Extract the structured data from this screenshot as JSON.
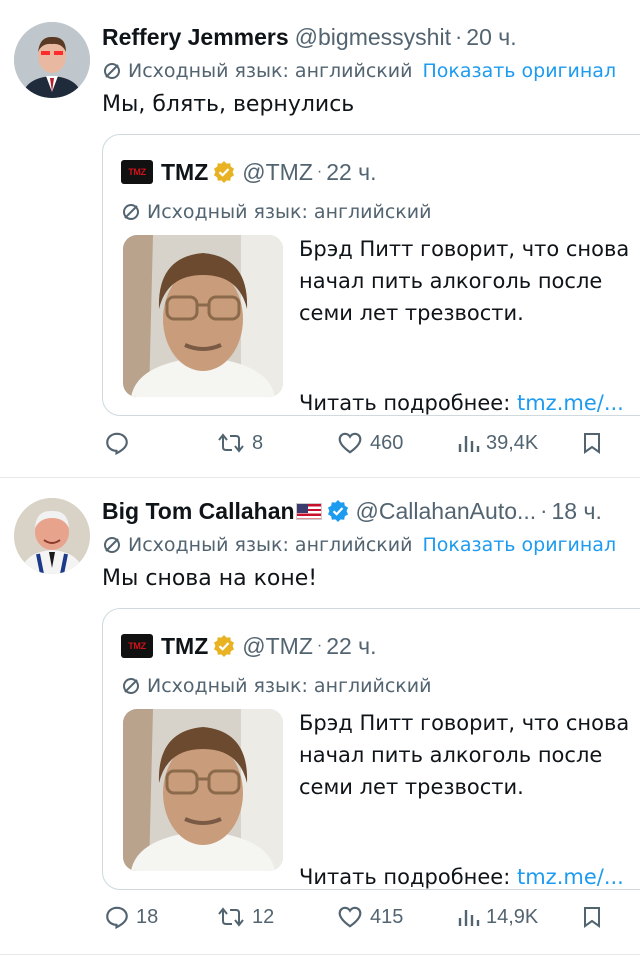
{
  "tweets": [
    {
      "author": {
        "name": "Reffery Jemmers",
        "handle": "@bigmessyshit",
        "time": "20 ч."
      },
      "translated_label": "Исходный язык: английский",
      "show_original": "Показать оригинал",
      "text": "Мы, блять, вернулись",
      "quote": {
        "logo_text": "TMZ",
        "name": "TMZ",
        "handle": "@TMZ",
        "time": "22 ч.",
        "translated_label": "Исходный язык: английский",
        "lines": [
          "Брэд Питт говорит, что снова",
          "начал пить алкоголь после",
          "семи лет трезвости."
        ],
        "read_more": "Читать подробнее: ",
        "link": "tmz.me/..."
      },
      "stats": {
        "replies": "",
        "retweets": "8",
        "likes": "460",
        "views": "39,4K"
      }
    },
    {
      "author": {
        "name": "Big Tom Callahan",
        "handle": "@CallahanAuto...",
        "time": "18 ч."
      },
      "translated_label": "Исходный язык: английский",
      "show_original": "Показать оригинал",
      "text": "Мы снова на коне!",
      "quote": {
        "logo_text": "TMZ",
        "name": "TMZ",
        "handle": "@TMZ",
        "time": "22 ч.",
        "translated_label": "Исходный язык: английский",
        "lines": [
          "Брэд Питт говорит, что снова",
          "начал пить алкоголь после",
          "семи лет трезвости."
        ],
        "read_more": "Читать подробнее: ",
        "link": "tmz.me/..."
      },
      "stats": {
        "replies": "18",
        "retweets": "12",
        "likes": "415",
        "views": "14,9K"
      }
    }
  ],
  "separator": "·",
  "colors": {
    "link": "#1d9bf0",
    "muted": "#536471",
    "verified_blue": "#1d9bf0",
    "verified_gold": "#e8b223"
  }
}
